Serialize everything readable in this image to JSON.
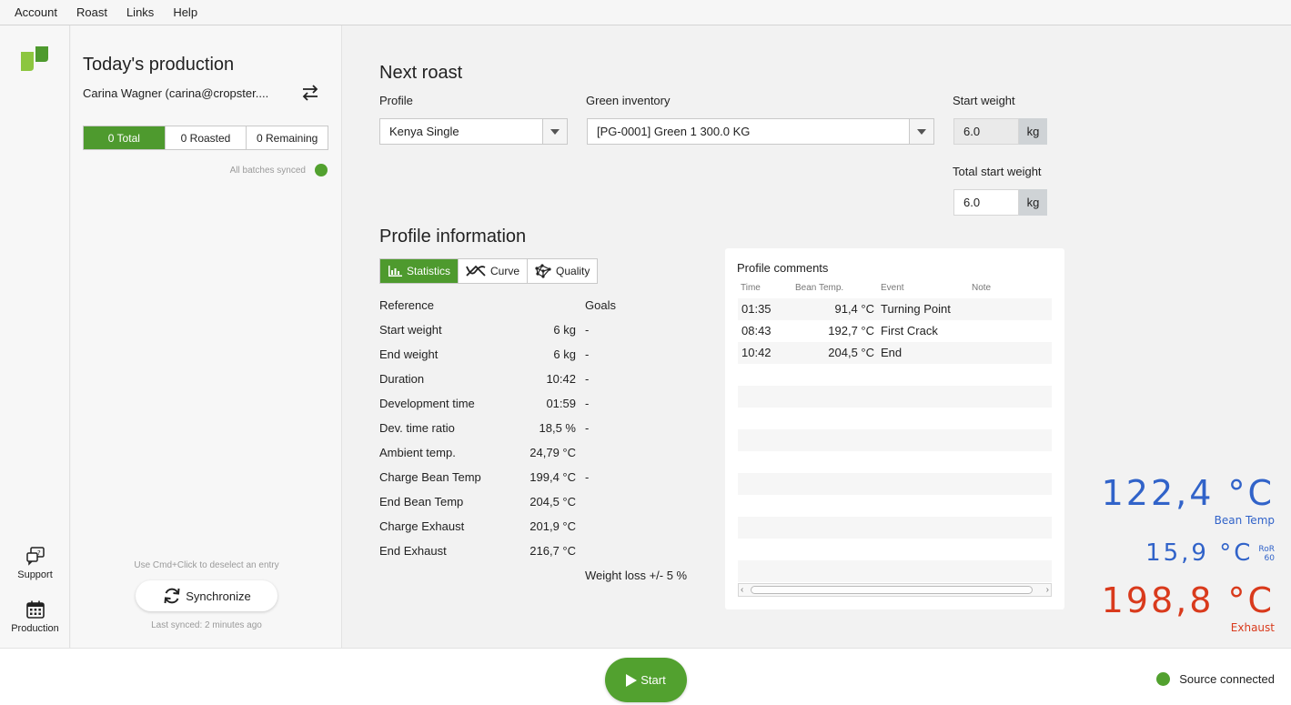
{
  "menu": [
    "Account",
    "Roast",
    "Links",
    "Help"
  ],
  "rail": {
    "support_label": "Support",
    "production_label": "Production"
  },
  "production": {
    "title": "Today's production",
    "user": "Carina Wagner (carina@cropster....",
    "segments": [
      {
        "label": "0 Total",
        "active": true
      },
      {
        "label": "0 Roasted",
        "active": false
      },
      {
        "label": "0 Remaining",
        "active": false
      }
    ],
    "synced_text": "All batches synced",
    "hint": "Use Cmd+Click to deselect an entry",
    "sync_button": "Synchronize",
    "last_synced": "Last synced: 2 minutes ago"
  },
  "next_roast": {
    "title": "Next roast",
    "profile_label": "Profile",
    "profile_value": "Kenya Single",
    "inventory_label": "Green inventory",
    "inventory_value": "[PG-0001] Green 1 300.0 KG",
    "start_weight_label": "Start weight",
    "start_weight_value": "6.0",
    "start_weight_unit": "kg",
    "total_start_weight_label": "Total start weight",
    "total_start_weight_value": "6.0",
    "total_start_weight_unit": "kg"
  },
  "profile_info": {
    "title": "Profile information",
    "tabs": [
      {
        "label": "Statistics",
        "icon": "bar-chart-icon",
        "active": true
      },
      {
        "label": "Curve",
        "icon": "curve-icon",
        "active": false
      },
      {
        "label": "Quality",
        "icon": "quality-icon",
        "active": false
      }
    ],
    "reference_header": "Reference",
    "goals_header": "Goals",
    "rows": [
      {
        "label": "Start weight",
        "value": "6 kg",
        "goal": "-"
      },
      {
        "label": "End weight",
        "value": "6 kg",
        "goal": "-"
      },
      {
        "label": "Duration",
        "value": "10:42",
        "goal": "-"
      },
      {
        "label": "Development time",
        "value": "01:59",
        "goal": "-"
      },
      {
        "label": "Dev. time ratio",
        "value": "18,5 %",
        "goal": "-"
      },
      {
        "label": "Ambient temp.",
        "value": "24,79 °C",
        "goal": ""
      },
      {
        "label": "Charge Bean Temp",
        "value": "199,4 °C",
        "goal": "-"
      },
      {
        "label": "End Bean Temp",
        "value": "204,5 °C",
        "goal": ""
      },
      {
        "label": "Charge Exhaust",
        "value": "201,9 °C",
        "goal": ""
      },
      {
        "label": "End Exhaust",
        "value": "216,7 °C",
        "goal": ""
      }
    ],
    "weight_loss_goal": "Weight loss +/- 5 %"
  },
  "comments": {
    "title": "Profile comments",
    "headers": {
      "time": "Time",
      "bean_temp": "Bean Temp.",
      "event": "Event",
      "note": "Note"
    },
    "rows": [
      {
        "time": "01:35",
        "bean_temp": "91,4 °C",
        "event": "Turning Point",
        "note": ""
      },
      {
        "time": "08:43",
        "bean_temp": "192,7 °C",
        "event": "First Crack",
        "note": ""
      },
      {
        "time": "10:42",
        "bean_temp": "204,5 °C",
        "event": "End",
        "note": ""
      }
    ]
  },
  "readouts": {
    "bean_temp_value": "122,4 °C",
    "bean_temp_label": "Bean Temp",
    "ror_value": "15,9 °C",
    "ror_label_top": "RoR",
    "ror_label_bottom": "60",
    "exhaust_value": "198,8 °C",
    "exhaust_label": "Exhaust",
    "colors": {
      "bean": "#3163c9",
      "exhaust": "#d93a1c",
      "accent": "#4e9a2e"
    }
  },
  "footer": {
    "start_button": "Start",
    "source_status": "Source connected"
  }
}
